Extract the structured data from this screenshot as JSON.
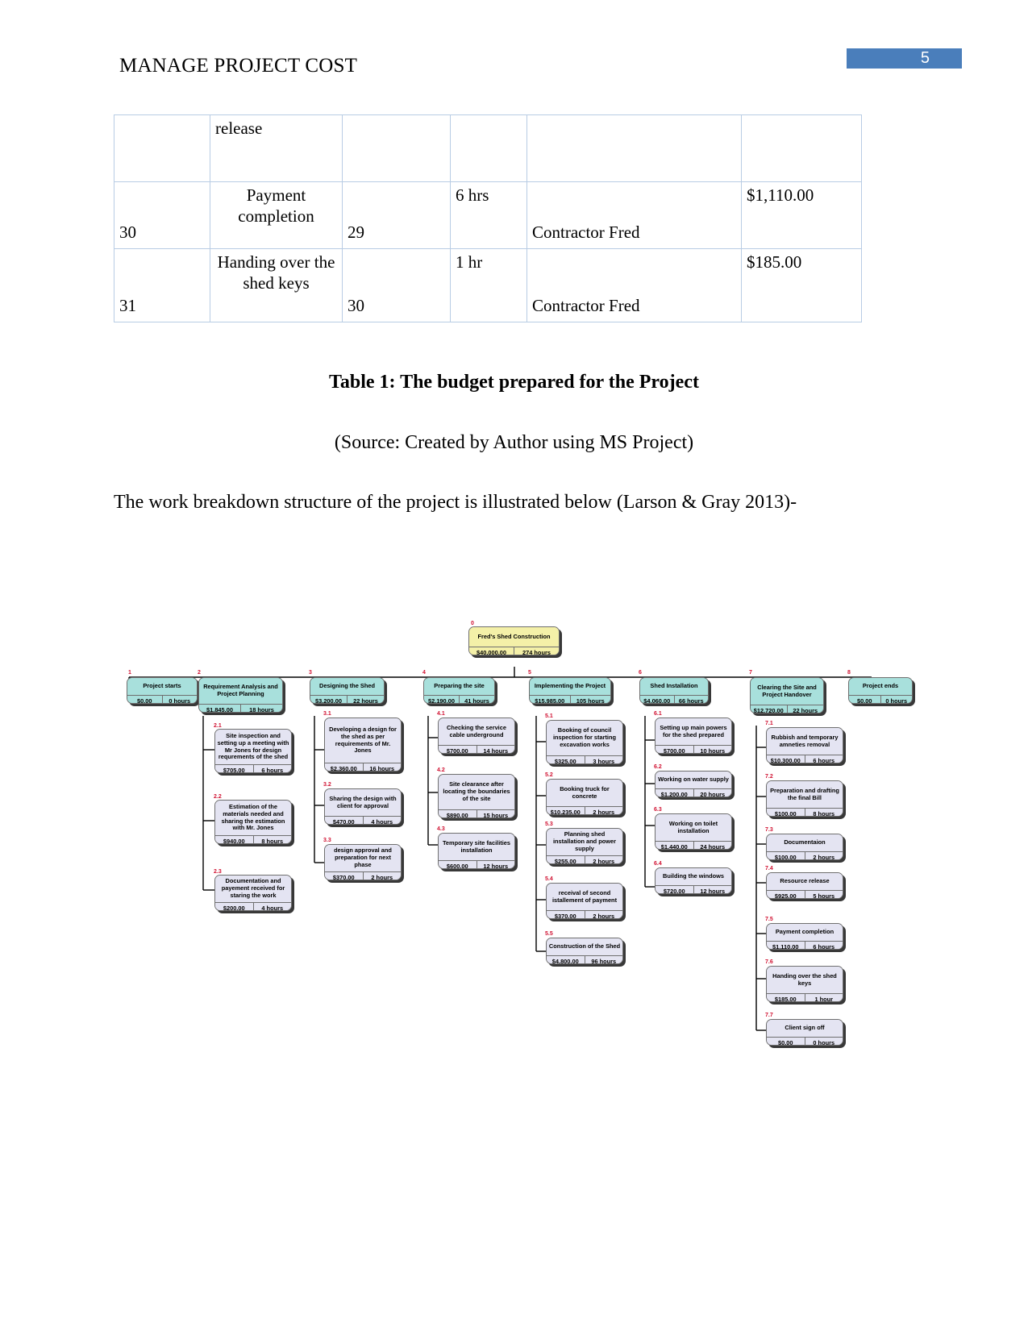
{
  "header": {
    "doc_title": "MANAGE PROJECT COST",
    "page_number": "5",
    "page_number_bg": "#4a7ebb"
  },
  "budget_table": {
    "rows": [
      {
        "id": "",
        "task": "release",
        "pred": "",
        "dur": "",
        "resource": "",
        "cost": ""
      },
      {
        "id": "30",
        "task": "Payment completion",
        "pred": "29",
        "dur": "6 hrs",
        "resource": "Contractor Fred",
        "cost": "$1,110.00"
      },
      {
        "id": "31",
        "task": "Handing over the shed keys",
        "pred": "30",
        "dur": "1 hr",
        "resource": "Contractor Fred",
        "cost": "$185.00"
      }
    ]
  },
  "captions": {
    "table_caption": "Table 1: The budget prepared for the Project",
    "source_caption": "(Source: Created by Author using MS Project)",
    "body_paragraph": "The work breakdown structure of the project is illustrated below (Larson & Gray 2013)-"
  },
  "chart_data": {
    "type": "diagram",
    "title": "Work Breakdown Structure",
    "colors": {
      "root": "#f4f0a8",
      "level1": "#a8e0dc",
      "level2": "#e4e4f2",
      "number": "#d01030"
    },
    "nodes": [
      {
        "wbs": "0",
        "label": "Fred's Shed Construction",
        "cost": "$40,000.00",
        "hours": "274 hours"
      },
      {
        "wbs": "1",
        "label": "Project starts",
        "cost": "$0.00",
        "hours": "0 hours"
      },
      {
        "wbs": "2",
        "label": "Requirement Analysis and Project Planning",
        "cost": "$1,845.00",
        "hours": "18 hours"
      },
      {
        "wbs": "3",
        "label": "Designing the Shed",
        "cost": "$3,200.00",
        "hours": "22 hours"
      },
      {
        "wbs": "4",
        "label": "Preparing the site",
        "cost": "$2,190.00",
        "hours": "41 hours"
      },
      {
        "wbs": "5",
        "label": "Implementing the Project",
        "cost": "$15,985.00",
        "hours": "105 hours"
      },
      {
        "wbs": "6",
        "label": "Shed Installation",
        "cost": "$4,060.00",
        "hours": "66 hours"
      },
      {
        "wbs": "7",
        "label": "Clearing the Site and Project Handover",
        "cost": "$12,720.00",
        "hours": "22 hours"
      },
      {
        "wbs": "8",
        "label": "Project ends",
        "cost": "$0.00",
        "hours": "0 hours"
      },
      {
        "wbs": "2.1",
        "label": "Site inspection and setting up a meeting with Mr Jones for design requrements of the shed",
        "cost": "$705.00",
        "hours": "6 hours"
      },
      {
        "wbs": "2.2",
        "label": "Estimation of the materials needed and sharing the estimation with Mr. Jones",
        "cost": "$940.00",
        "hours": "8 hours"
      },
      {
        "wbs": "2.3",
        "label": "Documentation and payement received for staring the work",
        "cost": "$200.00",
        "hours": "4 hours"
      },
      {
        "wbs": "3.1",
        "label": "Developing a design for the shed as per requirements of Mr. Jones",
        "cost": "$2,360.00",
        "hours": "16 hours"
      },
      {
        "wbs": "3.2",
        "label": "Sharing the design with client for approval",
        "cost": "$470.00",
        "hours": "4 hours"
      },
      {
        "wbs": "3.3",
        "label": "design approval and preparation for next phase",
        "cost": "$370.00",
        "hours": "2 hours"
      },
      {
        "wbs": "4.1",
        "label": "Checking the service cable underground",
        "cost": "$700.00",
        "hours": "14 hours"
      },
      {
        "wbs": "4.2",
        "label": "Site clearance after locating the boundaries of the site",
        "cost": "$890.00",
        "hours": "15 hours"
      },
      {
        "wbs": "4.3",
        "label": "Temporary site facilities installation",
        "cost": "$600.00",
        "hours": "12 hours"
      },
      {
        "wbs": "5.1",
        "label": "Booking of council inspection for starting excavation works",
        "cost": "$325.00",
        "hours": "3 hours"
      },
      {
        "wbs": "5.2",
        "label": "Booking truck for concrete",
        "cost": "$10,235.00",
        "hours": "2 hours"
      },
      {
        "wbs": "5.3",
        "label": "Planning shed installation and power supply",
        "cost": "$255.00",
        "hours": "2 hours"
      },
      {
        "wbs": "5.4",
        "label": "receival of second istallement of payment",
        "cost": "$370.00",
        "hours": "2 hours"
      },
      {
        "wbs": "5.5",
        "label": "Construction of the Shed",
        "cost": "$4,800.00",
        "hours": "96 hours"
      },
      {
        "wbs": "6.1",
        "label": "Setting up main powers for the shed prepared",
        "cost": "$700.00",
        "hours": "10 hours"
      },
      {
        "wbs": "6.2",
        "label": "Working on water supply",
        "cost": "$1,200.00",
        "hours": "20 hours"
      },
      {
        "wbs": "6.3",
        "label": "Working on toilet installation",
        "cost": "$1,440.00",
        "hours": "24 hours"
      },
      {
        "wbs": "6.4",
        "label": "Building the windows",
        "cost": "$720.00",
        "hours": "12 hours"
      },
      {
        "wbs": "7.1",
        "label": "Rubbish and temporary amneties removal",
        "cost": "$10,300.00",
        "hours": "6 hours"
      },
      {
        "wbs": "7.2",
        "label": "Preparation and drafting the final Bill",
        "cost": "$100.00",
        "hours": "8 hours"
      },
      {
        "wbs": "7.3",
        "label": "Documentaion",
        "cost": "$100.00",
        "hours": "2 hours"
      },
      {
        "wbs": "7.4",
        "label": "Resource release",
        "cost": "$925.00",
        "hours": "5 hours"
      },
      {
        "wbs": "7.5",
        "label": "Payment completion",
        "cost": "$1,110.00",
        "hours": "6 hours"
      },
      {
        "wbs": "7.6",
        "label": "Handing over the shed keys",
        "cost": "$185.00",
        "hours": "1 hour"
      },
      {
        "wbs": "7.7",
        "label": "Client sign off",
        "cost": "$0.00",
        "hours": "0 hours"
      }
    ]
  }
}
